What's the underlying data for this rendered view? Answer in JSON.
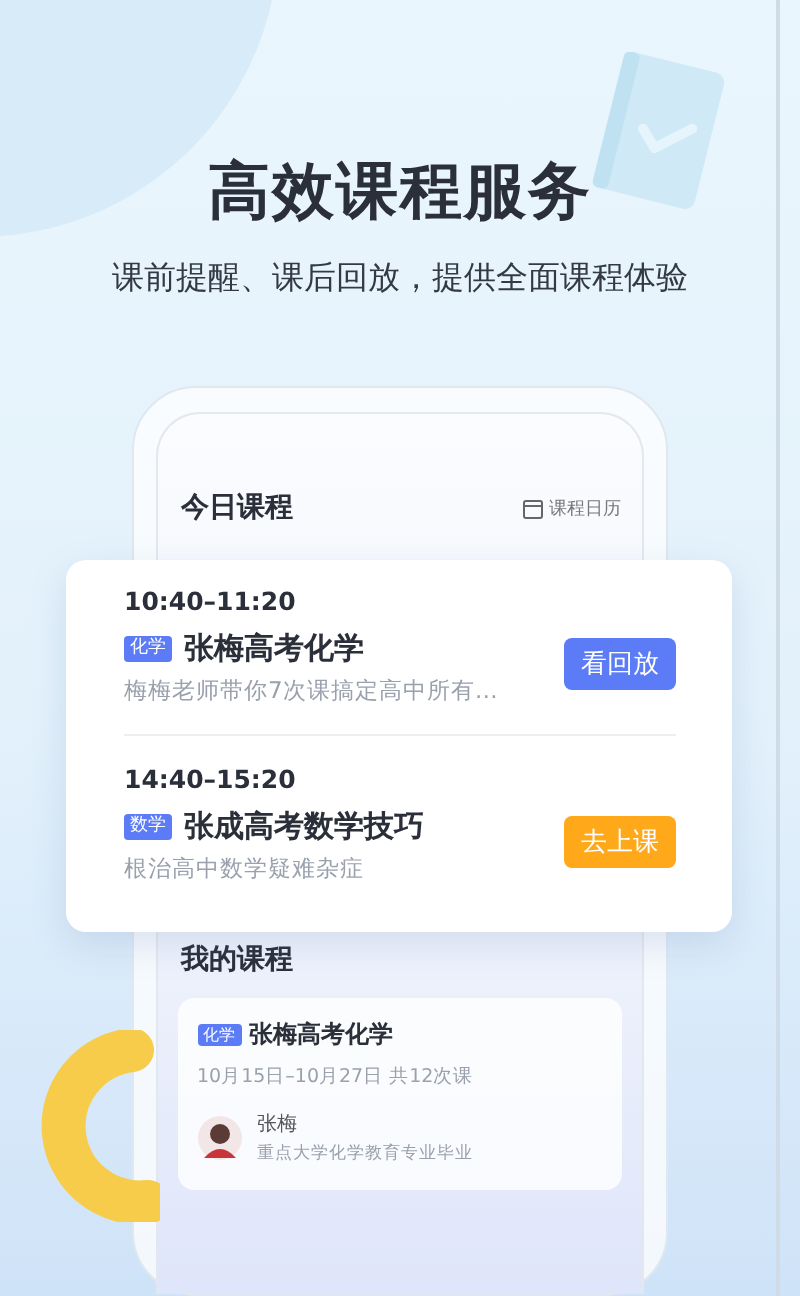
{
  "title": "高效课程服务",
  "subtitle": "课前提醒、课后回放，提供全面课程体验",
  "today": {
    "heading": "今日课程",
    "calendar_link": "课程日历"
  },
  "lessons": [
    {
      "time": "10:40–11:20",
      "tag": "化学",
      "name": "张梅高考化学",
      "description": "梅梅老师带你7次课搞定高中所有…",
      "action": {
        "label": "看回放",
        "kind": "replay"
      }
    },
    {
      "time": "14:40–15:20",
      "tag": "数学",
      "name": "张成高考数学技巧",
      "description": "根治高中数学疑难杂症",
      "action": {
        "label": "去上课",
        "kind": "join"
      }
    }
  ],
  "my_courses": {
    "heading": "我的课程",
    "course": {
      "tag": "化学",
      "name": "张梅高考化学",
      "dates": "10月15日–10月27日 共12次课",
      "teacher": {
        "name": "张梅",
        "bio": "重点大学化学教育专业毕业"
      }
    }
  }
}
